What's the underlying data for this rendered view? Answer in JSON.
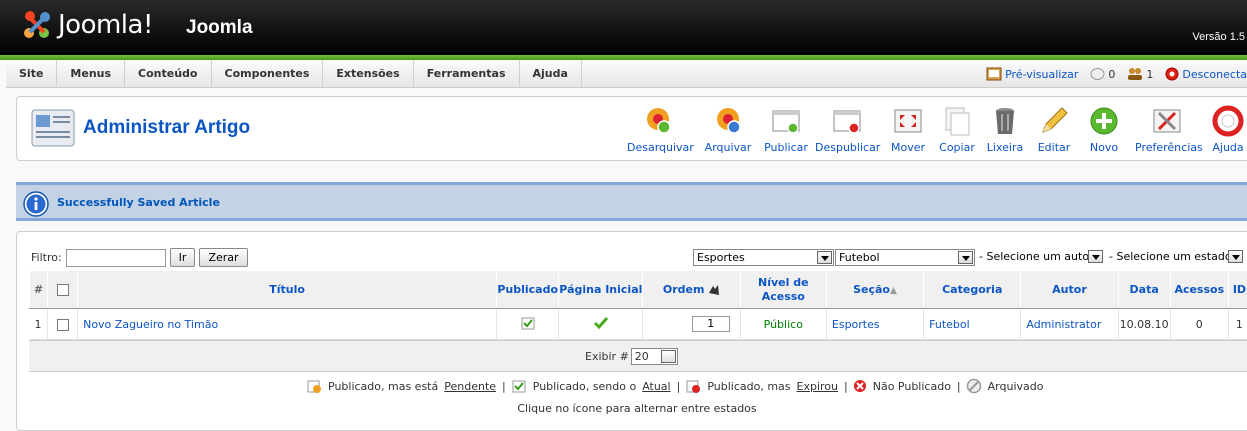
{
  "header": {
    "logo_text": "Joomla!",
    "site_name": "Joomla",
    "version": "Versão 1.5"
  },
  "menu": {
    "items": [
      "Site",
      "Menus",
      "Conteúdo",
      "Componentes",
      "Extensões",
      "Ferramentas",
      "Ajuda"
    ],
    "preview": "Pré-visualizar",
    "messages_count": "0",
    "users_count": "1",
    "logout": "Desconecta"
  },
  "toolbar": {
    "title": "Administrar Artigo",
    "buttons": [
      "Desarquivar",
      "Arquivar",
      "Publicar",
      "Despublicar",
      "Mover",
      "Copiar",
      "Lixeira",
      "Editar",
      "Novo",
      "Preferências",
      "Ajuda"
    ]
  },
  "message": "Successfully Saved Article",
  "filter": {
    "label": "Filtro:",
    "value": "",
    "go": "Ir",
    "reset": "Zerar",
    "section": "Esportes",
    "category": "Futebol",
    "author": "- Selecione um autor -",
    "state": "- Selecione um estado -"
  },
  "table": {
    "headers": {
      "num": "#",
      "title": "Título",
      "published": "Publicado",
      "frontpage": "Página Inicial",
      "order": "Ordem",
      "access": "Nível de Acesso",
      "section": "Seção",
      "category": "Categoria",
      "author": "Autor",
      "date": "Data",
      "hits": "Acessos",
      "id": "ID"
    },
    "rows": [
      {
        "num": "1",
        "title": "Novo Zagueiro no Timão",
        "order": "1",
        "access": "Público",
        "section": "Esportes",
        "category": "Futebol",
        "author": "Administrator",
        "date": "10.08.10",
        "hits": "0",
        "id": "1"
      }
    ]
  },
  "pager": {
    "label": "Exibir #",
    "value": "20"
  },
  "legend": {
    "pending_pre": "Publicado, mas está",
    "pending_link": "Pendente",
    "current_pre": "Publicado, sendo o",
    "current_link": "Atual",
    "expired_pre": "Publicado, mas",
    "expired_link": "Expirou",
    "unpublished": "Não Publicado",
    "archived": "Arquivado",
    "separator": "|"
  },
  "hint": "Clique no ícone para alternar entre estados",
  "colors": {
    "header_bg": "#000000",
    "accent_green": "#5aad2a",
    "link_blue": "#0b55c4",
    "message_bg": "#c3d2e5",
    "access_green": "#008000"
  }
}
